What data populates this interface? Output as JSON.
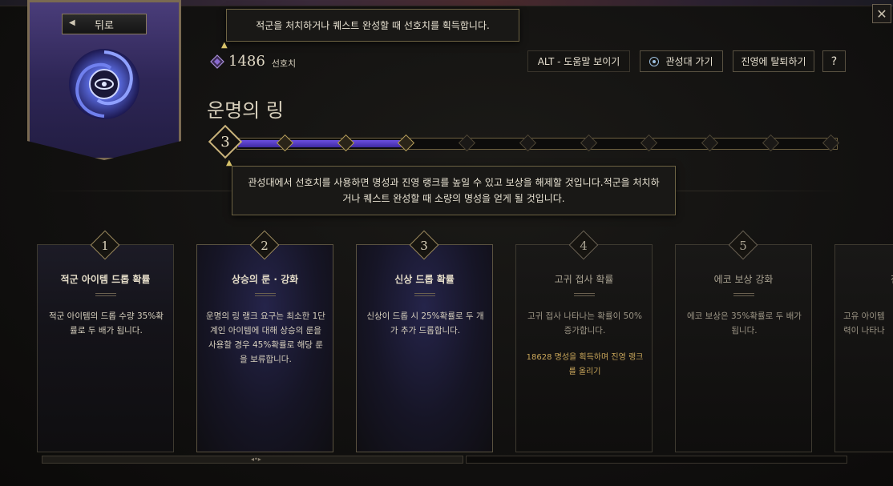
{
  "nav": {
    "back_label": "뒤로"
  },
  "tooltips": {
    "top": "적군을 처치하거나 퀘스트 완성할 때 선호치를 획득합니다.",
    "middle": "관성대에서 선호치를 사용하면 명성과 진영 랭크를 높일 수 있고 보상을 해제할 것입니다.적군을 처치하거나 퀘스트 완성할 때 소량의 명성을 얻게 될 것입니다."
  },
  "points": {
    "value": "1486",
    "label": "선호치"
  },
  "toolbar": {
    "alt_help": "ALT - 도움말 보이기",
    "observatory": "관성대 가기",
    "leave_faction": "진영에 탈퇴하기",
    "help": "?"
  },
  "title": "운명의 링",
  "progress": {
    "rank": "3",
    "filled_nodes": 3,
    "total_nodes": 10
  },
  "cards": [
    {
      "num": "1",
      "title": "적군 아이템 드롭 확률",
      "desc": "적군 아이템의 드롭 수량 35%확률로 두 배가 됩니다.",
      "state": "active"
    },
    {
      "num": "2",
      "title": "상승의 룬 · 강화",
      "desc": "운명의 링 랭크 요구는 최소한 1단계인 아이템에 대해 상승의 룬을 사용할 경우 45%확률로 해당 룬을 보류합니다.",
      "state": "active"
    },
    {
      "num": "3",
      "title": "신상 드롭 확률",
      "desc": "신상이 드롭 시 25%확률로 두 개가 추가 드롭합니다.",
      "state": "active"
    },
    {
      "num": "4",
      "title": "고귀 접사 확률",
      "desc": "고귀 접사 나타나는 확률이 50% 증가합니다.",
      "req": "18628 명성을 획득하며 진영 랭크를 올리기",
      "state": "locked"
    },
    {
      "num": "5",
      "title": "에코 보상 강화",
      "desc": "에코 보상은 35%확률로 두 배가 됩니다.",
      "state": "locked"
    }
  ],
  "partial_card": {
    "title": "전설적",
    "desc": "고유 아이템 력이 나타나"
  },
  "colors": {
    "accent": "#6c4fe0",
    "gold": "#c8b27a",
    "requirement": "#c9a65a"
  },
  "icons": {
    "close": "close-icon",
    "back": "chevron-left-icon",
    "points": "gem-icon",
    "observatory": "eye-icon"
  }
}
